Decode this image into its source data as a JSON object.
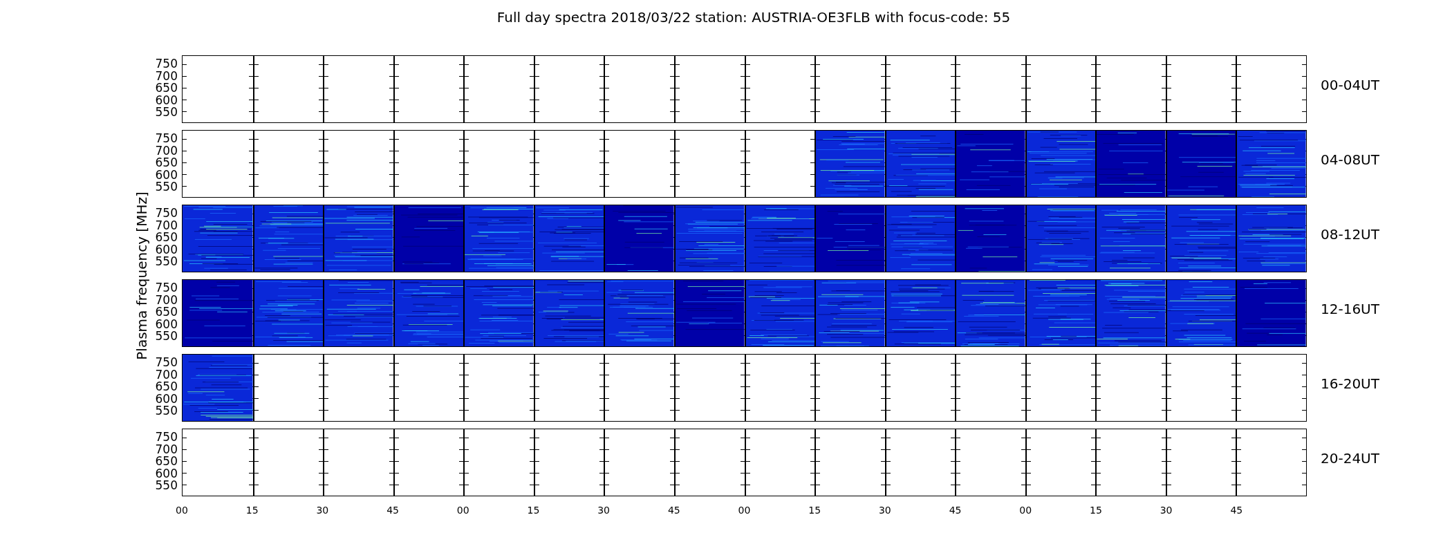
{
  "title": "Full day spectra 2018/03/22 station: AUSTRIA-OE3FLB with focus-code: 55",
  "ylabel": "Plasma frequency [MHz]",
  "rows": [
    {
      "label": "00-04UT",
      "y_ticks": [
        "750",
        "700",
        "650",
        "600",
        "550"
      ],
      "cells": [
        {
          "kind": "empty"
        },
        {
          "kind": "empty"
        },
        {
          "kind": "empty"
        },
        {
          "kind": "empty"
        },
        {
          "kind": "empty"
        },
        {
          "kind": "empty"
        },
        {
          "kind": "empty"
        },
        {
          "kind": "empty"
        },
        {
          "kind": "empty"
        },
        {
          "kind": "empty"
        },
        {
          "kind": "empty"
        },
        {
          "kind": "empty"
        },
        {
          "kind": "empty"
        },
        {
          "kind": "empty"
        },
        {
          "kind": "empty"
        },
        {
          "kind": "empty"
        }
      ]
    },
    {
      "label": "04-08UT",
      "y_ticks": [
        "750",
        "700",
        "650",
        "600",
        "550"
      ],
      "cells": [
        {
          "kind": "empty"
        },
        {
          "kind": "empty"
        },
        {
          "kind": "empty"
        },
        {
          "kind": "empty"
        },
        {
          "kind": "empty"
        },
        {
          "kind": "empty"
        },
        {
          "kind": "empty"
        },
        {
          "kind": "empty"
        },
        {
          "kind": "empty"
        },
        {
          "kind": "noisy"
        },
        {
          "kind": "noisy"
        },
        {
          "kind": "dark"
        },
        {
          "kind": "noisy"
        },
        {
          "kind": "dark"
        },
        {
          "kind": "dark"
        },
        {
          "kind": "noisy"
        }
      ]
    },
    {
      "label": "08-12UT",
      "y_ticks": [
        "750",
        "700",
        "650",
        "600",
        "550"
      ],
      "cells": [
        {
          "kind": "noisy"
        },
        {
          "kind": "noisy"
        },
        {
          "kind": "noisy"
        },
        {
          "kind": "dark"
        },
        {
          "kind": "noisy"
        },
        {
          "kind": "noisy"
        },
        {
          "kind": "dark"
        },
        {
          "kind": "noisy"
        },
        {
          "kind": "noisy"
        },
        {
          "kind": "dark"
        },
        {
          "kind": "noisy"
        },
        {
          "kind": "dark"
        },
        {
          "kind": "noisy"
        },
        {
          "kind": "noisy"
        },
        {
          "kind": "noisy"
        },
        {
          "kind": "noisy"
        }
      ]
    },
    {
      "label": "12-16UT",
      "y_ticks": [
        "750",
        "700",
        "650",
        "600",
        "550"
      ],
      "cells": [
        {
          "kind": "dark"
        },
        {
          "kind": "noisy"
        },
        {
          "kind": "noisy"
        },
        {
          "kind": "noisy"
        },
        {
          "kind": "noisy"
        },
        {
          "kind": "noisy"
        },
        {
          "kind": "noisy"
        },
        {
          "kind": "dark"
        },
        {
          "kind": "noisy"
        },
        {
          "kind": "noisy"
        },
        {
          "kind": "noisy"
        },
        {
          "kind": "noisy"
        },
        {
          "kind": "noisy"
        },
        {
          "kind": "noisy"
        },
        {
          "kind": "noisy"
        },
        {
          "kind": "dark"
        }
      ]
    },
    {
      "label": "16-20UT",
      "y_ticks": [
        "750",
        "700",
        "650",
        "600",
        "550"
      ],
      "cells": [
        {
          "kind": "noisy"
        },
        {
          "kind": "empty"
        },
        {
          "kind": "empty"
        },
        {
          "kind": "empty"
        },
        {
          "kind": "empty"
        },
        {
          "kind": "empty"
        },
        {
          "kind": "empty"
        },
        {
          "kind": "empty"
        },
        {
          "kind": "empty"
        },
        {
          "kind": "empty"
        },
        {
          "kind": "empty"
        },
        {
          "kind": "empty"
        },
        {
          "kind": "empty"
        },
        {
          "kind": "empty"
        },
        {
          "kind": "empty"
        },
        {
          "kind": "empty"
        }
      ]
    },
    {
      "label": "20-24UT",
      "y_ticks": [
        "750",
        "700",
        "650",
        "600",
        "550"
      ],
      "cells": [
        {
          "kind": "empty"
        },
        {
          "kind": "empty"
        },
        {
          "kind": "empty"
        },
        {
          "kind": "empty"
        },
        {
          "kind": "empty"
        },
        {
          "kind": "empty"
        },
        {
          "kind": "empty"
        },
        {
          "kind": "empty"
        },
        {
          "kind": "empty"
        },
        {
          "kind": "empty"
        },
        {
          "kind": "empty"
        },
        {
          "kind": "empty"
        },
        {
          "kind": "empty"
        },
        {
          "kind": "empty"
        },
        {
          "kind": "empty"
        },
        {
          "kind": "empty"
        }
      ]
    }
  ],
  "x_ticks": [
    "00",
    "15",
    "30",
    "45",
    "00",
    "15",
    "30",
    "45",
    "00",
    "15",
    "30",
    "45",
    "00",
    "15",
    "30",
    "45"
  ]
}
